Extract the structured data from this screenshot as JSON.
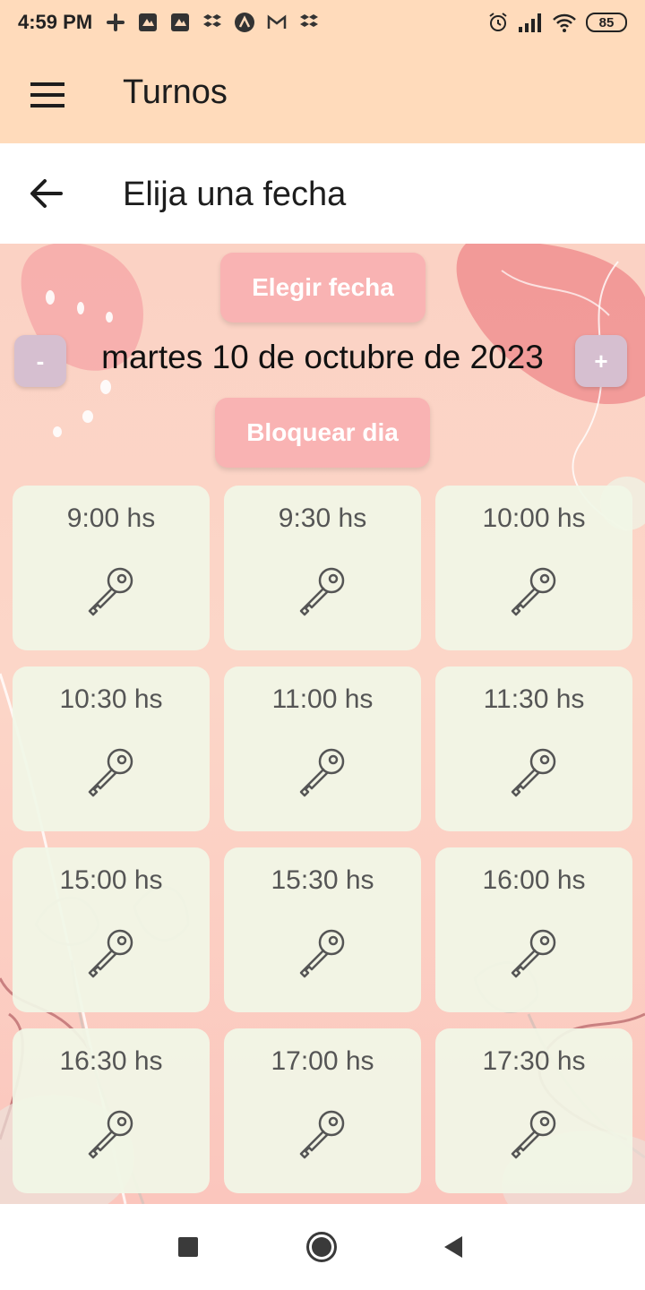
{
  "status_bar": {
    "time": "4:59 PM",
    "battery": "85",
    "icons": [
      "slack-icon",
      "app-icon",
      "app-icon",
      "dropbox-icon",
      "arc-icon",
      "gmail-icon",
      "dropbox-icon",
      "alarm-icon",
      "signal-icon",
      "wifi-icon",
      "battery-icon"
    ]
  },
  "app_bar": {
    "title": "Turnos",
    "menu_icon": "menu-icon"
  },
  "sub_header": {
    "title": "Elija una fecha",
    "back_icon": "arrow-left-icon"
  },
  "date_controls": {
    "choose_label": "Elegir fecha",
    "minus_label": "-",
    "plus_label": "+",
    "date": "martes 10 de octubre de 2023",
    "block_label": "Bloquear dia"
  },
  "slots": [
    {
      "time": "9:00 hs"
    },
    {
      "time": "9:30 hs"
    },
    {
      "time": "10:00 hs"
    },
    {
      "time": "10:30 hs"
    },
    {
      "time": "11:00 hs"
    },
    {
      "time": "11:30 hs"
    },
    {
      "time": "15:00 hs"
    },
    {
      "time": "15:30 hs"
    },
    {
      "time": "16:00 hs"
    },
    {
      "time": "16:30 hs"
    },
    {
      "time": "17:00 hs"
    },
    {
      "time": "17:30 hs"
    }
  ],
  "nav_bar": {
    "icons": [
      "recents-icon",
      "home-icon",
      "back-icon"
    ]
  },
  "colors": {
    "header": "#ffdbbb",
    "button": "#f9b3b3",
    "stepper": "#d6bfd0",
    "slot": "#f1f6e6"
  }
}
